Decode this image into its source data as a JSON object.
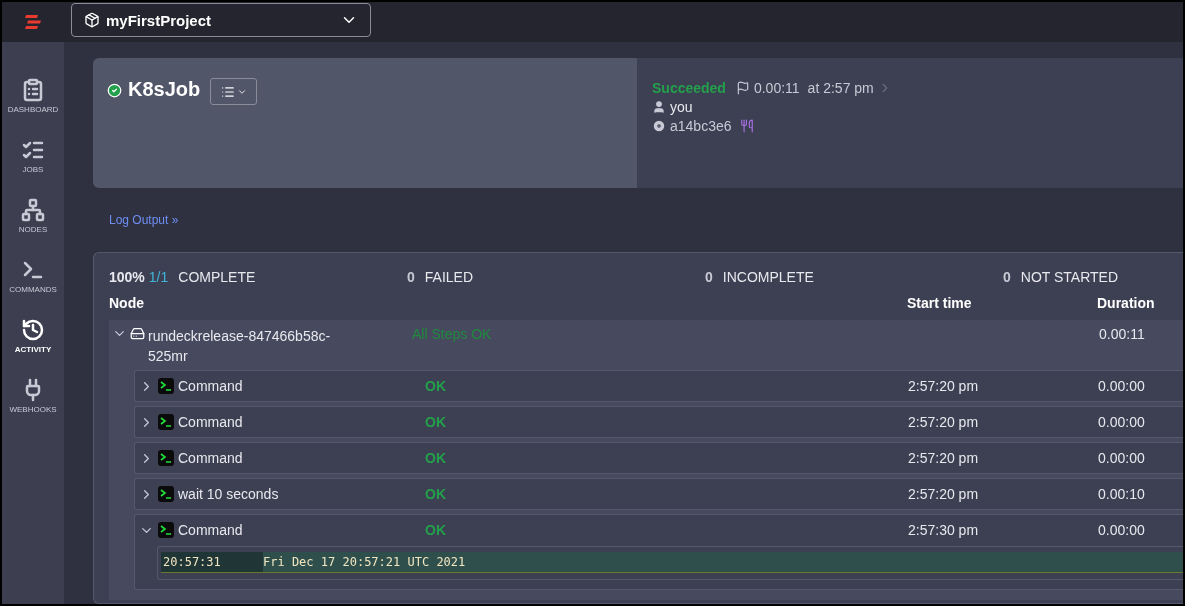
{
  "topbar": {
    "project": "myFirstProject"
  },
  "sidebar": {
    "items": [
      {
        "kind": "dashboard",
        "label": "DASHBOARD",
        "selected": false
      },
      {
        "kind": "jobs",
        "label": "JOBS",
        "selected": false
      },
      {
        "kind": "nodes",
        "label": "NODES",
        "selected": false
      },
      {
        "kind": "commands",
        "label": "COMMANDS",
        "selected": false
      },
      {
        "kind": "activity",
        "label": "ACTIVITY",
        "selected": true
      },
      {
        "kind": "webhooks",
        "label": "WEBHOOKS",
        "selected": false
      }
    ]
  },
  "job": {
    "name": "K8sJob",
    "status_label": "Succeeded",
    "duration": "0.00:11",
    "time": "at 2:57 pm",
    "user": "you",
    "commit": "a14bc3e6"
  },
  "log_link": "Log Output »",
  "summary": [
    {
      "kind": "progress",
      "percent": "100%",
      "fraction": "1/1",
      "label": "COMPLETE"
    },
    {
      "kind": "count",
      "count": "0",
      "label": "FAILED"
    },
    {
      "kind": "count",
      "count": "0",
      "label": "INCOMPLETE"
    },
    {
      "kind": "count",
      "count": "0",
      "label": "NOT STARTED"
    }
  ],
  "columns": [
    "Node",
    "Start time",
    "Duration"
  ],
  "node": {
    "name": "rundeckrelease-847466b58c-525mr",
    "expanded": true,
    "status": "All Steps OK",
    "duration": "0.00:11",
    "steps": [
      {
        "name": "Command",
        "status": "OK",
        "start": "2:57:20 pm",
        "duration": "0.00:00",
        "expanded": false
      },
      {
        "name": "Command",
        "status": "OK",
        "start": "2:57:20 pm",
        "duration": "0.00:00",
        "expanded": false
      },
      {
        "name": "Command",
        "status": "OK",
        "start": "2:57:20 pm",
        "duration": "0.00:00",
        "expanded": false
      },
      {
        "name": "wait 10 seconds",
        "status": "OK",
        "start": "2:57:20 pm",
        "duration": "0.00:10",
        "expanded": false
      },
      {
        "name": "Command",
        "status": "OK",
        "start": "2:57:30 pm",
        "duration": "0.00:00",
        "expanded": true,
        "log": [
          {
            "time": "20:57:31",
            "text": "Fri Dec 17 20:57:21 UTC 2021"
          }
        ]
      }
    ]
  }
}
